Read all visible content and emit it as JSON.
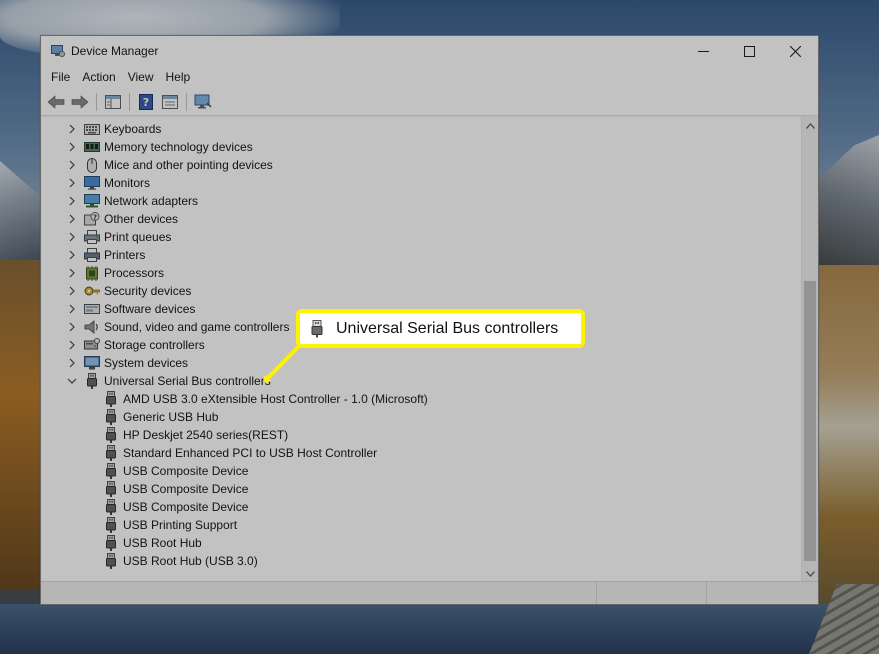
{
  "window": {
    "title": "Device Manager",
    "menu": [
      "File",
      "Action",
      "View",
      "Help"
    ]
  },
  "tree": {
    "categories": [
      {
        "label": "Keyboards",
        "icon": "keyboard-icon"
      },
      {
        "label": "Memory technology devices",
        "icon": "memory-icon"
      },
      {
        "label": "Mice and other pointing devices",
        "icon": "mouse-icon"
      },
      {
        "label": "Monitors",
        "icon": "monitor-icon"
      },
      {
        "label": "Network adapters",
        "icon": "network-adapter-icon"
      },
      {
        "label": "Other devices",
        "icon": "unknown-device-icon"
      },
      {
        "label": "Print queues",
        "icon": "print-queue-icon"
      },
      {
        "label": "Printers",
        "icon": "printer-icon"
      },
      {
        "label": "Processors",
        "icon": "processor-icon"
      },
      {
        "label": "Security devices",
        "icon": "security-key-icon"
      },
      {
        "label": "Software devices",
        "icon": "software-device-icon"
      },
      {
        "label": "Sound, video and game controllers",
        "icon": "speaker-icon"
      },
      {
        "label": "Storage controllers",
        "icon": "storage-icon"
      },
      {
        "label": "System devices",
        "icon": "system-device-icon"
      }
    ],
    "expanded": {
      "label": "Universal Serial Bus controllers",
      "icon": "usb-plug-icon",
      "children": [
        "AMD USB 3.0 eXtensible Host Controller - 1.0 (Microsoft)",
        "Generic USB Hub",
        "HP Deskjet 2540 series(REST)",
        "Standard Enhanced PCI to USB Host Controller",
        "USB Composite Device",
        "USB Composite Device",
        "USB Composite Device",
        "USB Printing Support",
        "USB Root Hub",
        "USB Root Hub (USB 3.0)"
      ]
    }
  },
  "callout": {
    "label": "Universal Serial Bus controllers",
    "border_color": "#fff200"
  }
}
